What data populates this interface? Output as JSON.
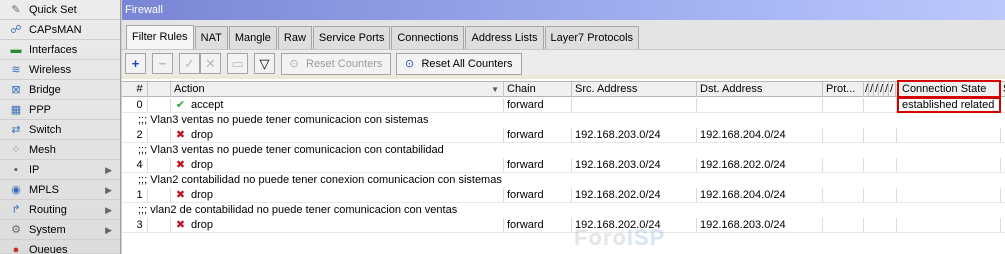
{
  "sidebar": {
    "items": [
      {
        "label": "Quick Set",
        "icon": "wrench-icon",
        "glyph": "✎",
        "color": "#6b6b6b",
        "submenu": false
      },
      {
        "label": "CAPsMAN",
        "icon": "capsman-icon",
        "glyph": "☍",
        "color": "#3a6fb5",
        "submenu": false
      },
      {
        "label": "Interfaces",
        "icon": "interfaces-icon",
        "glyph": "▬",
        "color": "#2f8a2f",
        "submenu": false
      },
      {
        "label": "Wireless",
        "icon": "wireless-icon",
        "glyph": "≋",
        "color": "#3a6fb5",
        "submenu": false
      },
      {
        "label": "Bridge",
        "icon": "bridge-icon",
        "glyph": "⊠",
        "color": "#3a6fb5",
        "submenu": false
      },
      {
        "label": "PPP",
        "icon": "ppp-icon",
        "glyph": "▦",
        "color": "#3a6fb5",
        "submenu": false
      },
      {
        "label": "Switch",
        "icon": "switch-icon",
        "glyph": "⇄",
        "color": "#3a6fb5",
        "submenu": false
      },
      {
        "label": "Mesh",
        "icon": "mesh-icon",
        "glyph": "⁘",
        "color": "#3a6fb5",
        "submenu": false
      },
      {
        "label": "IP",
        "icon": "ip-icon",
        "glyph": "▪",
        "color": "#555555",
        "submenu": true
      },
      {
        "label": "MPLS",
        "icon": "mpls-icon",
        "glyph": "◉",
        "color": "#3a6fb5",
        "submenu": true
      },
      {
        "label": "Routing",
        "icon": "routing-icon",
        "glyph": "↱",
        "color": "#3a6fb5",
        "submenu": true
      },
      {
        "label": "System",
        "icon": "system-gear-icon",
        "glyph": "⚙",
        "color": "#6b6b6b",
        "submenu": true
      },
      {
        "label": "Queues",
        "icon": "queues-icon",
        "glyph": "●",
        "color": "#c03030",
        "submenu": false
      }
    ]
  },
  "window": {
    "title": "Firewall",
    "tabs": [
      "Filter Rules",
      "NAT",
      "Mangle",
      "Raw",
      "Service Ports",
      "Connections",
      "Address Lists",
      "Layer7 Protocols"
    ],
    "active_tab": 0
  },
  "toolbar": {
    "add_glyph": "+",
    "remove_glyph": "−",
    "enable_glyph": "✓",
    "disable_glyph": "✕",
    "comment_glyph": "▭",
    "filter_glyph": "▽",
    "reset_counters": "Reset Counters",
    "reset_all_counters": "Reset All Counters"
  },
  "table": {
    "columns": {
      "num": "#",
      "action": "Action",
      "chain": "Chain",
      "src": "Src. Address",
      "dst": "Dst. Address",
      "proto": "Prot...",
      "narrow": "/",
      "conn_state": "Connection State",
      "extra": "S"
    },
    "rows": [
      {
        "type": "data",
        "num": "0",
        "action": "accept",
        "chain": "forward",
        "src": "",
        "dst": "",
        "conn_state": "established related"
      },
      {
        "type": "comment",
        "text": ";;; Vlan3 ventas no puede tener comunicacion con sistemas"
      },
      {
        "type": "data",
        "num": "2",
        "action": "drop",
        "chain": "forward",
        "src": "192.168.203.0/24",
        "dst": "192.168.204.0/24",
        "conn_state": ""
      },
      {
        "type": "comment",
        "text": ";;; Vlan3 ventas no puede tener comunicacion con contabilidad"
      },
      {
        "type": "data",
        "num": "4",
        "action": "drop",
        "chain": "forward",
        "src": "192.168.203.0/24",
        "dst": "192.168.202.0/24",
        "conn_state": ""
      },
      {
        "type": "comment",
        "text": ";;; Vlan2 contabilidad no puede tener conexion comunicacion con sistemas"
      },
      {
        "type": "data",
        "num": "1",
        "action": "drop",
        "chain": "forward",
        "src": "192.168.202.0/24",
        "dst": "192.168.204.0/24",
        "conn_state": ""
      },
      {
        "type": "comment",
        "text": ";;; vlan2 de contabilidad no puede tener comunicacion con ventas"
      },
      {
        "type": "data",
        "num": "3",
        "action": "drop",
        "chain": "forward",
        "src": "192.168.202.0/24",
        "dst": "192.168.203.0/24",
        "conn_state": ""
      }
    ]
  },
  "icons": {
    "accept": "✔",
    "drop": "✖",
    "submenu_arrow": "▶",
    "sort_arrow": "▼"
  },
  "watermark": {
    "part1": "Foro",
    "part2": "ISP"
  },
  "colors": {
    "highlight": "#d40000",
    "accept": "#2fa82f",
    "drop": "#c0121f",
    "titlebar": "#7985d5"
  }
}
